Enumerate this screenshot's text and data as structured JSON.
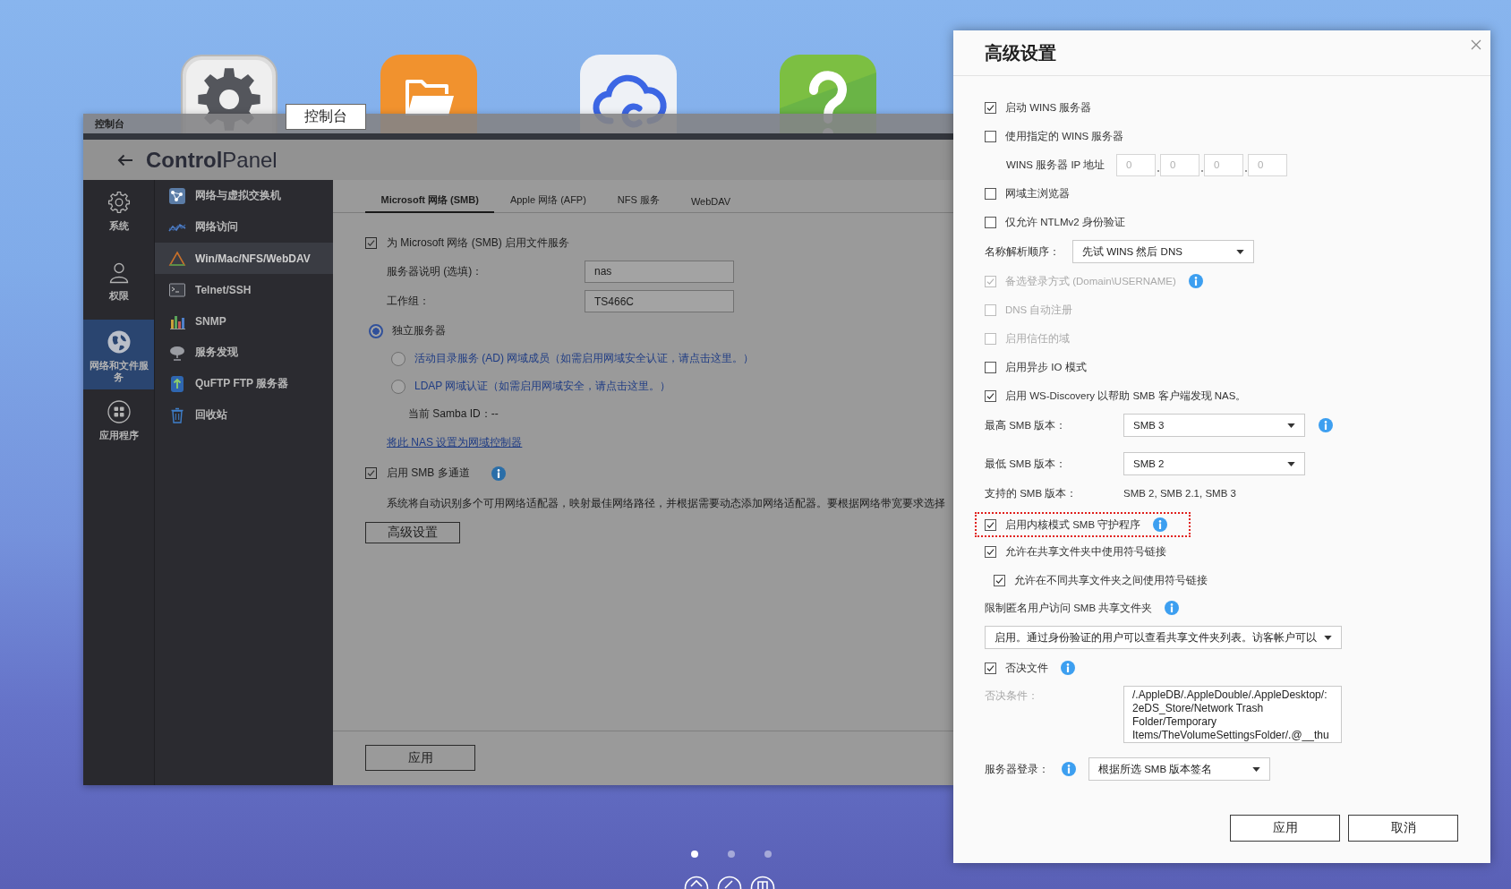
{
  "desktop": {
    "apps": [
      {
        "kind": "settings"
      },
      {
        "kind": "files"
      },
      {
        "kind": "cloud"
      },
      {
        "kind": "help"
      }
    ],
    "tooltip": "控制台",
    "pages": [
      {
        "selected": true
      },
      {
        "selected": false
      },
      {
        "selected": false
      }
    ]
  },
  "window": {
    "title": "控制台",
    "header": "**Control**Panel",
    "rail": [
      {
        "kind": "system",
        "label": "系统",
        "selected": false
      },
      {
        "kind": "permissions",
        "label": "权限",
        "selected": false
      },
      {
        "kind": "network",
        "label": "网络和文件服务",
        "selected": true
      },
      {
        "kind": "apps",
        "label": "应用程序",
        "selected": false
      }
    ],
    "menu": [
      {
        "kind": "switch",
        "label": "网络与虚拟交换机",
        "selected": false
      },
      {
        "kind": "access",
        "label": "网络访问",
        "selected": false
      },
      {
        "kind": "protocols",
        "label": "Win/Mac/NFS/WebDAV",
        "selected": true
      },
      {
        "kind": "terminal",
        "label": "Telnet/SSH",
        "selected": false
      },
      {
        "kind": "snmp",
        "label": "SNMP",
        "selected": false
      },
      {
        "kind": "discovery",
        "label": "服务发现",
        "selected": false
      },
      {
        "kind": "ftp",
        "label": "QuFTP FTP 服务器",
        "selected": false
      },
      {
        "kind": "recycle",
        "label": "回收站",
        "selected": false
      }
    ],
    "tabs": [
      {
        "label": "Microsoft 网络 (SMB)",
        "selected": true
      },
      {
        "label": "Apple 网络 (AFP)",
        "selected": false
      },
      {
        "label": "NFS 服务",
        "selected": false
      },
      {
        "label": "WebDAV",
        "selected": false
      }
    ],
    "smb": {
      "enable": {
        "label": "为 Microsoft 网络 (SMB) 启用文件服务",
        "checked": true
      },
      "fields": [
        {
          "label": "服务器说明 (选填)：",
          "value": "nas"
        },
        {
          "label": "工作组：",
          "value": "TS466C"
        }
      ],
      "roles": [
        {
          "kind": "plain",
          "label": "独立服务器",
          "selected": true
        },
        {
          "kind": "link",
          "label": "活动目录服务 (AD) 网域成员（如需启用网域安全认证，请点击这里。）",
          "selected": false
        },
        {
          "kind": "link",
          "label": "LDAP 网域认证（如需启用网域安全，请点击这里。）",
          "selected": false
        }
      ],
      "samba_id": "当前 Samba ID：--",
      "domain_link": "将此 NAS 设置为网域控制器",
      "multichannel": {
        "label": "启用 SMB 多通道",
        "checked": true,
        "info": true
      },
      "description": "系统将自动识别多个可用网络适配器，映射最佳网络路径，并根据需要动态添加网络适配器。要根据网络带宽要求选择",
      "advanced_button": "高级设置"
    },
    "apply_button": "应用"
  },
  "dialog": {
    "title": "高级设置",
    "rows": [
      {
        "kind": "check",
        "label": "启动 WINS 服务器",
        "checked": true,
        "disabled": false,
        "highlighted": false
      },
      {
        "kind": "check",
        "label": "使用指定的 WINS 服务器",
        "checked": false,
        "disabled": false,
        "highlighted": false
      },
      {
        "kind": "ip",
        "label": "WINS 服务器 IP 地址",
        "octets": [
          "0",
          "0",
          "0",
          "0"
        ],
        "disabled": true
      },
      {
        "kind": "check",
        "label": "网域主浏览器",
        "checked": false,
        "disabled": false,
        "highlighted": false
      },
      {
        "kind": "check",
        "label": "仅允许 NTLMv2 身份验证",
        "checked": false,
        "disabled": false,
        "highlighted": false
      },
      {
        "kind": "inline_select",
        "label": "名称解析顺序：",
        "value": "先试 WINS 然后 DNS"
      },
      {
        "kind": "check",
        "label": "备选登录方式 (Domain\\USERNAME)",
        "checked": true,
        "disabled": true,
        "highlighted": false,
        "info": true
      },
      {
        "kind": "check",
        "label": "DNS 自动注册",
        "checked": false,
        "disabled": true,
        "highlighted": false
      },
      {
        "kind": "check",
        "label": "启用信任的域",
        "checked": false,
        "disabled": true,
        "highlighted": false
      },
      {
        "kind": "check",
        "label": "启用异步 IO 模式",
        "checked": false,
        "disabled": false,
        "highlighted": false
      },
      {
        "kind": "check",
        "label": "启用 WS-Discovery 以帮助 SMB 客户端发现 NAS。",
        "checked": true,
        "disabled": false,
        "highlighted": false
      },
      {
        "kind": "select",
        "label": "最高 SMB 版本：",
        "value": "SMB 3",
        "info": true
      },
      {
        "kind": "select",
        "label": "最低 SMB 版本：",
        "value": "SMB 2"
      },
      {
        "kind": "text",
        "label": "支持的 SMB 版本：",
        "value": "SMB 2, SMB 2.1, SMB 3"
      },
      {
        "kind": "check",
        "label": "启用内核模式 SMB 守护程序",
        "checked": true,
        "disabled": false,
        "highlighted": true,
        "info": true
      },
      {
        "kind": "check",
        "label": "允许在共享文件夹中使用符号链接",
        "checked": true,
        "disabled": false,
        "highlighted": false,
        "children": [
          {
            "label": "允许在不同共享文件夹之间使用符号链接",
            "checked": true,
            "disabled": false
          }
        ]
      },
      {
        "kind": "heading",
        "label": "限制匿名用户访问 SMB 共享文件夹",
        "info": true
      },
      {
        "kind": "wide_select",
        "value": "启用。通过身份验证的用户可以查看共享文件夹列表。访客帐户可以"
      },
      {
        "kind": "check",
        "label": "否决文件",
        "checked": true,
        "disabled": false,
        "highlighted": false,
        "info": true
      },
      {
        "kind": "textarea",
        "label": "否决条件：",
        "disabled": true,
        "value_lines": [
          "/.AppleDB/.AppleDouble/.AppleDesktop/:",
          "2eDS_Store/Network Trash",
          "Folder/Temporary",
          "Items/TheVolumeSettingsFolder/.@__thu"
        ]
      },
      {
        "kind": "inline_select",
        "label": "服务器登录：",
        "value": "根据所选 SMB 版本签名",
        "info": true
      }
    ],
    "buttons": [
      "应用",
      "取消"
    ]
  }
}
